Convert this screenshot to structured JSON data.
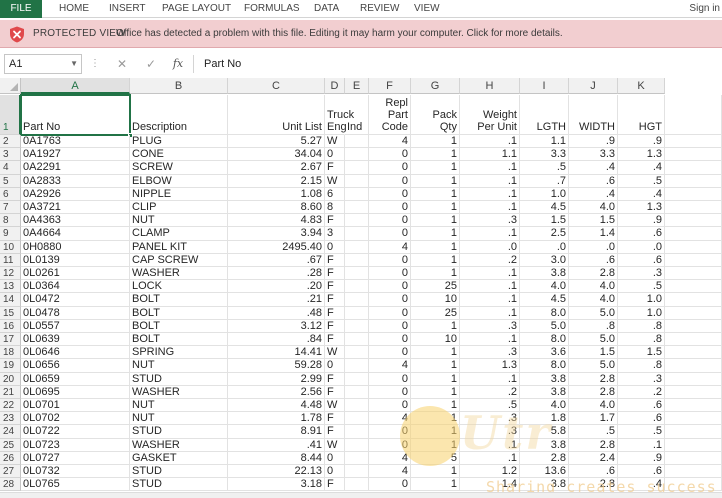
{
  "ribbon": {
    "file_tab": "FILE",
    "tabs": [
      "HOME",
      "INSERT",
      "PAGE LAYOUT",
      "FORMULAS",
      "DATA",
      "REVIEW",
      "VIEW"
    ],
    "sign_in": "Sign in"
  },
  "protected_view": {
    "title": "PROTECTED VIEW",
    "message": "Office has detected a problem with this file. Editing it may harm your computer. Click for more details."
  },
  "formula_bar": {
    "name_box": "A1",
    "cancel_symbol": "✕",
    "enter_symbol": "✓",
    "fx_symbol": "fx",
    "content": "Part No"
  },
  "columns": [
    "A",
    "B",
    "C",
    "D",
    "E",
    "F",
    "G",
    "H",
    "I",
    "J",
    "K"
  ],
  "header_row": {
    "row_number": "1",
    "cells": [
      [
        "Part No"
      ],
      [
        "Description"
      ],
      [
        "Unit List"
      ],
      [
        "Truck",
        "Eng"
      ],
      [
        "Ind"
      ],
      [
        "Repl",
        "Part",
        "Code"
      ],
      [
        "Pack",
        "Qty"
      ],
      [
        "Weight",
        "Per Unit"
      ],
      [
        "LGTH"
      ],
      [
        "WIDTH"
      ],
      [
        "HGT"
      ]
    ]
  },
  "rows": [
    {
      "n": "2",
      "c": [
        "0A1763",
        "PLUG",
        "5.27",
        "W",
        "",
        "4",
        "1",
        ".1",
        "1.1",
        ".9",
        ".9"
      ]
    },
    {
      "n": "3",
      "c": [
        "0A1927",
        "CONE",
        "34.04",
        "0",
        "",
        "0",
        "1",
        "1.1",
        "3.3",
        "3.3",
        "1.3"
      ]
    },
    {
      "n": "4",
      "c": [
        "0A2291",
        "SCREW",
        "2.67",
        "F",
        "",
        "0",
        "1",
        ".1",
        ".5",
        ".4",
        ".4"
      ]
    },
    {
      "n": "5",
      "c": [
        "0A2833",
        "ELBOW",
        "2.15",
        "W",
        "",
        "0",
        "1",
        ".1",
        ".7",
        ".6",
        ".5"
      ]
    },
    {
      "n": "6",
      "c": [
        "0A2926",
        "NIPPLE",
        "1.08",
        "6",
        "",
        "0",
        "1",
        ".1",
        "1.0",
        ".4",
        ".4"
      ]
    },
    {
      "n": "7",
      "c": [
        "0A3721",
        "CLIP",
        "8.60",
        "8",
        "",
        "0",
        "1",
        ".1",
        "4.5",
        "4.0",
        "1.3"
      ]
    },
    {
      "n": "8",
      "c": [
        "0A4363",
        "NUT",
        "4.83",
        "F",
        "",
        "0",
        "1",
        ".3",
        "1.5",
        "1.5",
        ".9"
      ]
    },
    {
      "n": "9",
      "c": [
        "0A4664",
        "CLAMP",
        "3.94",
        "3",
        "",
        "0",
        "1",
        ".1",
        "2.5",
        "1.4",
        ".6"
      ]
    },
    {
      "n": "10",
      "c": [
        "0H0880",
        "PANEL KIT",
        "2495.40",
        "0",
        "",
        "4",
        "1",
        ".0",
        ".0",
        ".0",
        ".0"
      ]
    },
    {
      "n": "11",
      "c": [
        "0L0139",
        "CAP SCREW",
        ".67",
        "F",
        "",
        "0",
        "1",
        ".2",
        "3.0",
        ".6",
        ".6"
      ]
    },
    {
      "n": "12",
      "c": [
        "0L0261",
        "WASHER",
        ".28",
        "F",
        "",
        "0",
        "1",
        ".1",
        "3.8",
        "2.8",
        ".3"
      ]
    },
    {
      "n": "13",
      "c": [
        "0L0364",
        "LOCK",
        ".20",
        "F",
        "",
        "0",
        "25",
        ".1",
        "4.0",
        "4.0",
        ".5"
      ]
    },
    {
      "n": "14",
      "c": [
        "0L0472",
        "BOLT",
        ".21",
        "F",
        "",
        "0",
        "10",
        ".1",
        "4.5",
        "4.0",
        "1.0"
      ]
    },
    {
      "n": "15",
      "c": [
        "0L0478",
        "BOLT",
        ".48",
        "F",
        "",
        "0",
        "25",
        ".1",
        "8.0",
        "5.0",
        "1.0"
      ]
    },
    {
      "n": "16",
      "c": [
        "0L0557",
        "BOLT",
        "3.12",
        "F",
        "",
        "0",
        "1",
        ".3",
        "5.0",
        ".8",
        ".8"
      ]
    },
    {
      "n": "17",
      "c": [
        "0L0639",
        "BOLT",
        ".84",
        "F",
        "",
        "0",
        "10",
        ".1",
        "8.0",
        "5.0",
        ".8"
      ]
    },
    {
      "n": "18",
      "c": [
        "0L0646",
        "SPRING",
        "14.41",
        "W",
        "",
        "0",
        "1",
        ".3",
        "3.6",
        "1.5",
        "1.5"
      ]
    },
    {
      "n": "19",
      "c": [
        "0L0656",
        "NUT",
        "59.28",
        "0",
        "",
        "4",
        "1",
        "1.3",
        "8.0",
        "5.0",
        ".8"
      ]
    },
    {
      "n": "20",
      "c": [
        "0L0659",
        "STUD",
        "2.99",
        "F",
        "",
        "0",
        "1",
        ".1",
        "3.8",
        "2.8",
        ".3"
      ]
    },
    {
      "n": "21",
      "c": [
        "0L0695",
        "WASHER",
        "2.56",
        "F",
        "",
        "0",
        "1",
        ".2",
        "3.8",
        "2.8",
        ".2"
      ]
    },
    {
      "n": "22",
      "c": [
        "0L0701",
        "NUT",
        "4.48",
        "W",
        "",
        "0",
        "1",
        ".5",
        "4.0",
        "4.0",
        ".6"
      ]
    },
    {
      "n": "23",
      "c": [
        "0L0702",
        "NUT",
        "1.78",
        "F",
        "",
        "4",
        "1",
        ".3",
        "1.8",
        "1.7",
        ".6"
      ]
    },
    {
      "n": "24",
      "c": [
        "0L0722",
        "STUD",
        "8.91",
        "F",
        "",
        "0",
        "1",
        ".3",
        "5.8",
        ".5",
        ".5"
      ]
    },
    {
      "n": "25",
      "c": [
        "0L0723",
        "WASHER",
        ".41",
        "W",
        "",
        "0",
        "1",
        ".1",
        "3.8",
        "2.8",
        ".1"
      ]
    },
    {
      "n": "26",
      "c": [
        "0L0727",
        "GASKET",
        "8.44",
        "0",
        "",
        "4",
        "5",
        ".1",
        "2.8",
        "2.4",
        ".9"
      ]
    },
    {
      "n": "27",
      "c": [
        "0L0732",
        "STUD",
        "22.13",
        "0",
        "",
        "4",
        "1",
        "1.2",
        "13.6",
        ".6",
        ".6"
      ]
    },
    {
      "n": "28",
      "c": [
        "0L0765",
        "STUD",
        "3.18",
        "F",
        "",
        "0",
        "1",
        "1.4",
        "3.8",
        "2.8",
        ".4"
      ]
    }
  ],
  "watermark": {
    "tagline": "Sharing creates success"
  }
}
